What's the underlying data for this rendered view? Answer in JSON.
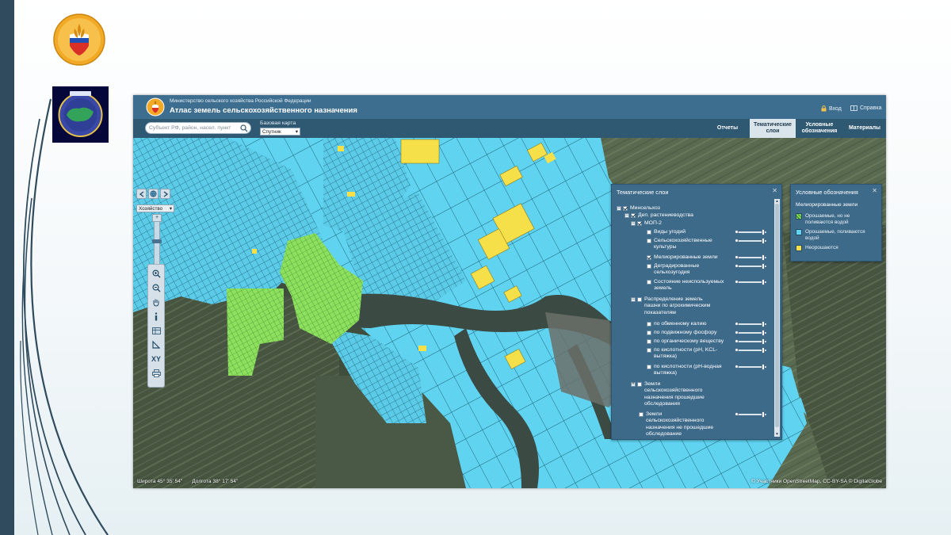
{
  "header": {
    "ministry": "Министерство сельского хозяйства Российской Федерации",
    "title": "Атлас земель сельскохозяйственного назначения",
    "login": "Вход",
    "help": "Справка"
  },
  "toolbar": {
    "search_placeholder": "Субъект РФ, район, насел. пункт",
    "basemap_label": "Базовая карта",
    "basemap_value": "Спутник",
    "tabs": [
      {
        "label": "Отчеты"
      },
      {
        "label": "Тематические слои"
      },
      {
        "label": "Условные обозначения"
      },
      {
        "label": "Материалы"
      }
    ]
  },
  "map_tools": {
    "scale_select": "Хозяйство",
    "zoom_in": "+",
    "zoom_out": "–",
    "xy_label": "XY",
    "coords": {
      "lat": "Широта 45° 35' 54\"",
      "lon": "Долгота 38° 17' 54\""
    },
    "attribution": "© Участники OpenStreetMap, CC-BY-SA © DigitalGlobe"
  },
  "layers": {
    "title": "Тематические слои",
    "items": [
      {
        "label": "Минсельхоз"
      },
      {
        "label": "Деп. растениеводства"
      },
      {
        "label": "МОП-2"
      },
      {
        "label": "Виды угодий"
      },
      {
        "label": "Сельскохозяйственные",
        "label2": "культуры"
      },
      {
        "label": "Мелиорированные земли"
      },
      {
        "label": "Деградированные",
        "label2": "сельхозугодия"
      },
      {
        "label": "Состояние неиспользуемых",
        "label2": "земель"
      },
      {
        "label": "Распределение земель",
        "label2": "пашни по агрохимическим",
        "label3": "показателям"
      },
      {
        "label": "по обменному калию"
      },
      {
        "label": "по подвижному фосфору"
      },
      {
        "label": "по органическому веществу"
      },
      {
        "label": "по кислотности (pH, KCL-",
        "label2": "вытяжка)"
      },
      {
        "label": "по кислотности (pH-водная",
        "label2": "вытяжка)"
      },
      {
        "label": "Земли",
        "label2": "сельскохозяйственного",
        "label3": "назначения прошедшие",
        "label4": "обследования"
      },
      {
        "label": "Земли",
        "label2": "сельскохозяйственного",
        "label3": "назначения не прошедшие",
        "label4": "обследование"
      }
    ]
  },
  "legend": {
    "title": "Условные обозначения",
    "section": "Мелиорированные земли",
    "items": [
      {
        "label": "Орошаемые, но не",
        "label2": "поливаются водой",
        "color": "#7ed957"
      },
      {
        "label": "Орошаемые, поливаются",
        "label2": "водой",
        "color": "#5fd3f0"
      },
      {
        "label": "Неорошаются",
        "color": "#f5e04a"
      }
    ]
  },
  "colors": {
    "header": "#3d6e8f",
    "irrigated": "#5fd3f0",
    "irrigated_not_watered": "#7ed957",
    "not_irrigated": "#f5e04a",
    "slide_bar": "#2f4b5d"
  }
}
